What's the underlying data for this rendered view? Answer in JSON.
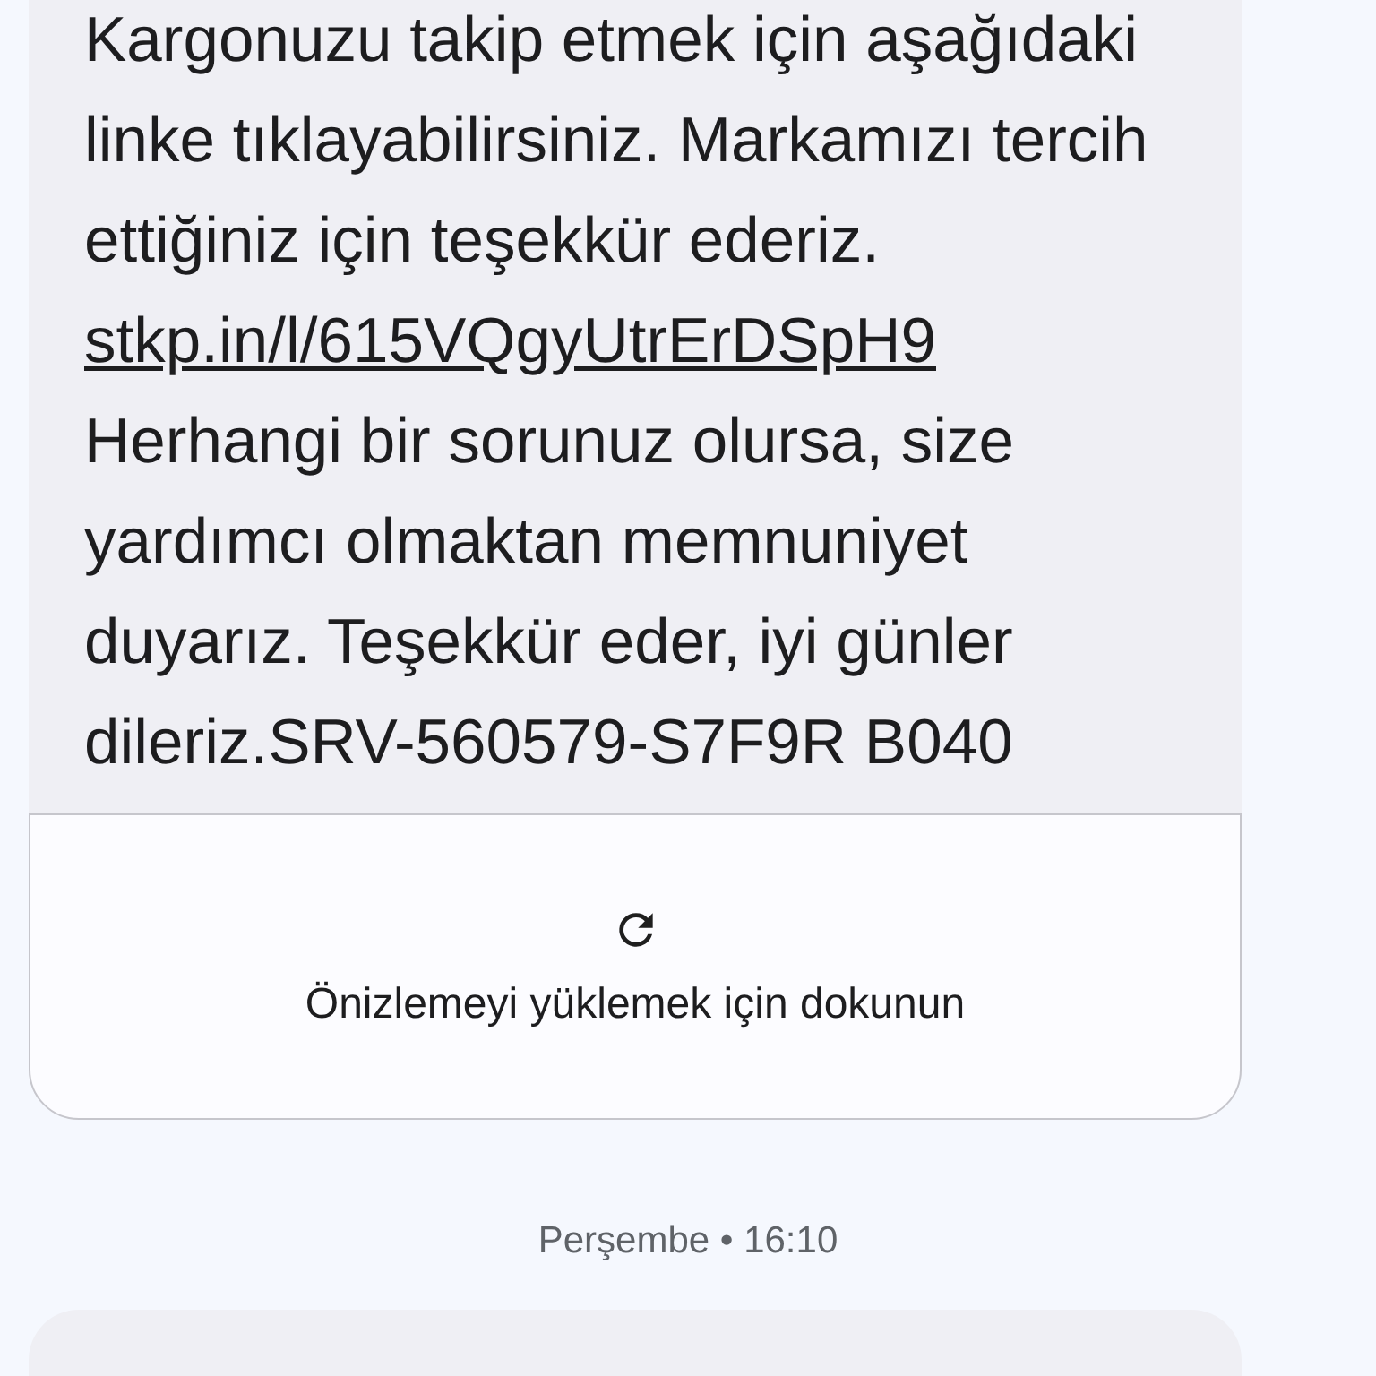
{
  "message": {
    "text_before": "Kargonuzu takip etmek için aşağıdaki linke tıklayabilirsiniz. Markamızı tercih ettiğiniz için teşekkür ederiz.",
    "link": "stkp.in/l/615VQgyUtrErDSpH9",
    "text_after": "Herhangi bir sorunuz olursa, size yardımcı olmaktan memnuniyet duyarız. Teşekkür eder, iyi günler dileriz.SRV-560579-S7F9R B040"
  },
  "preview": {
    "label": "Önizlemeyi yüklemek için dokunun"
  },
  "timestamp": "Perşembe • 16:10"
}
